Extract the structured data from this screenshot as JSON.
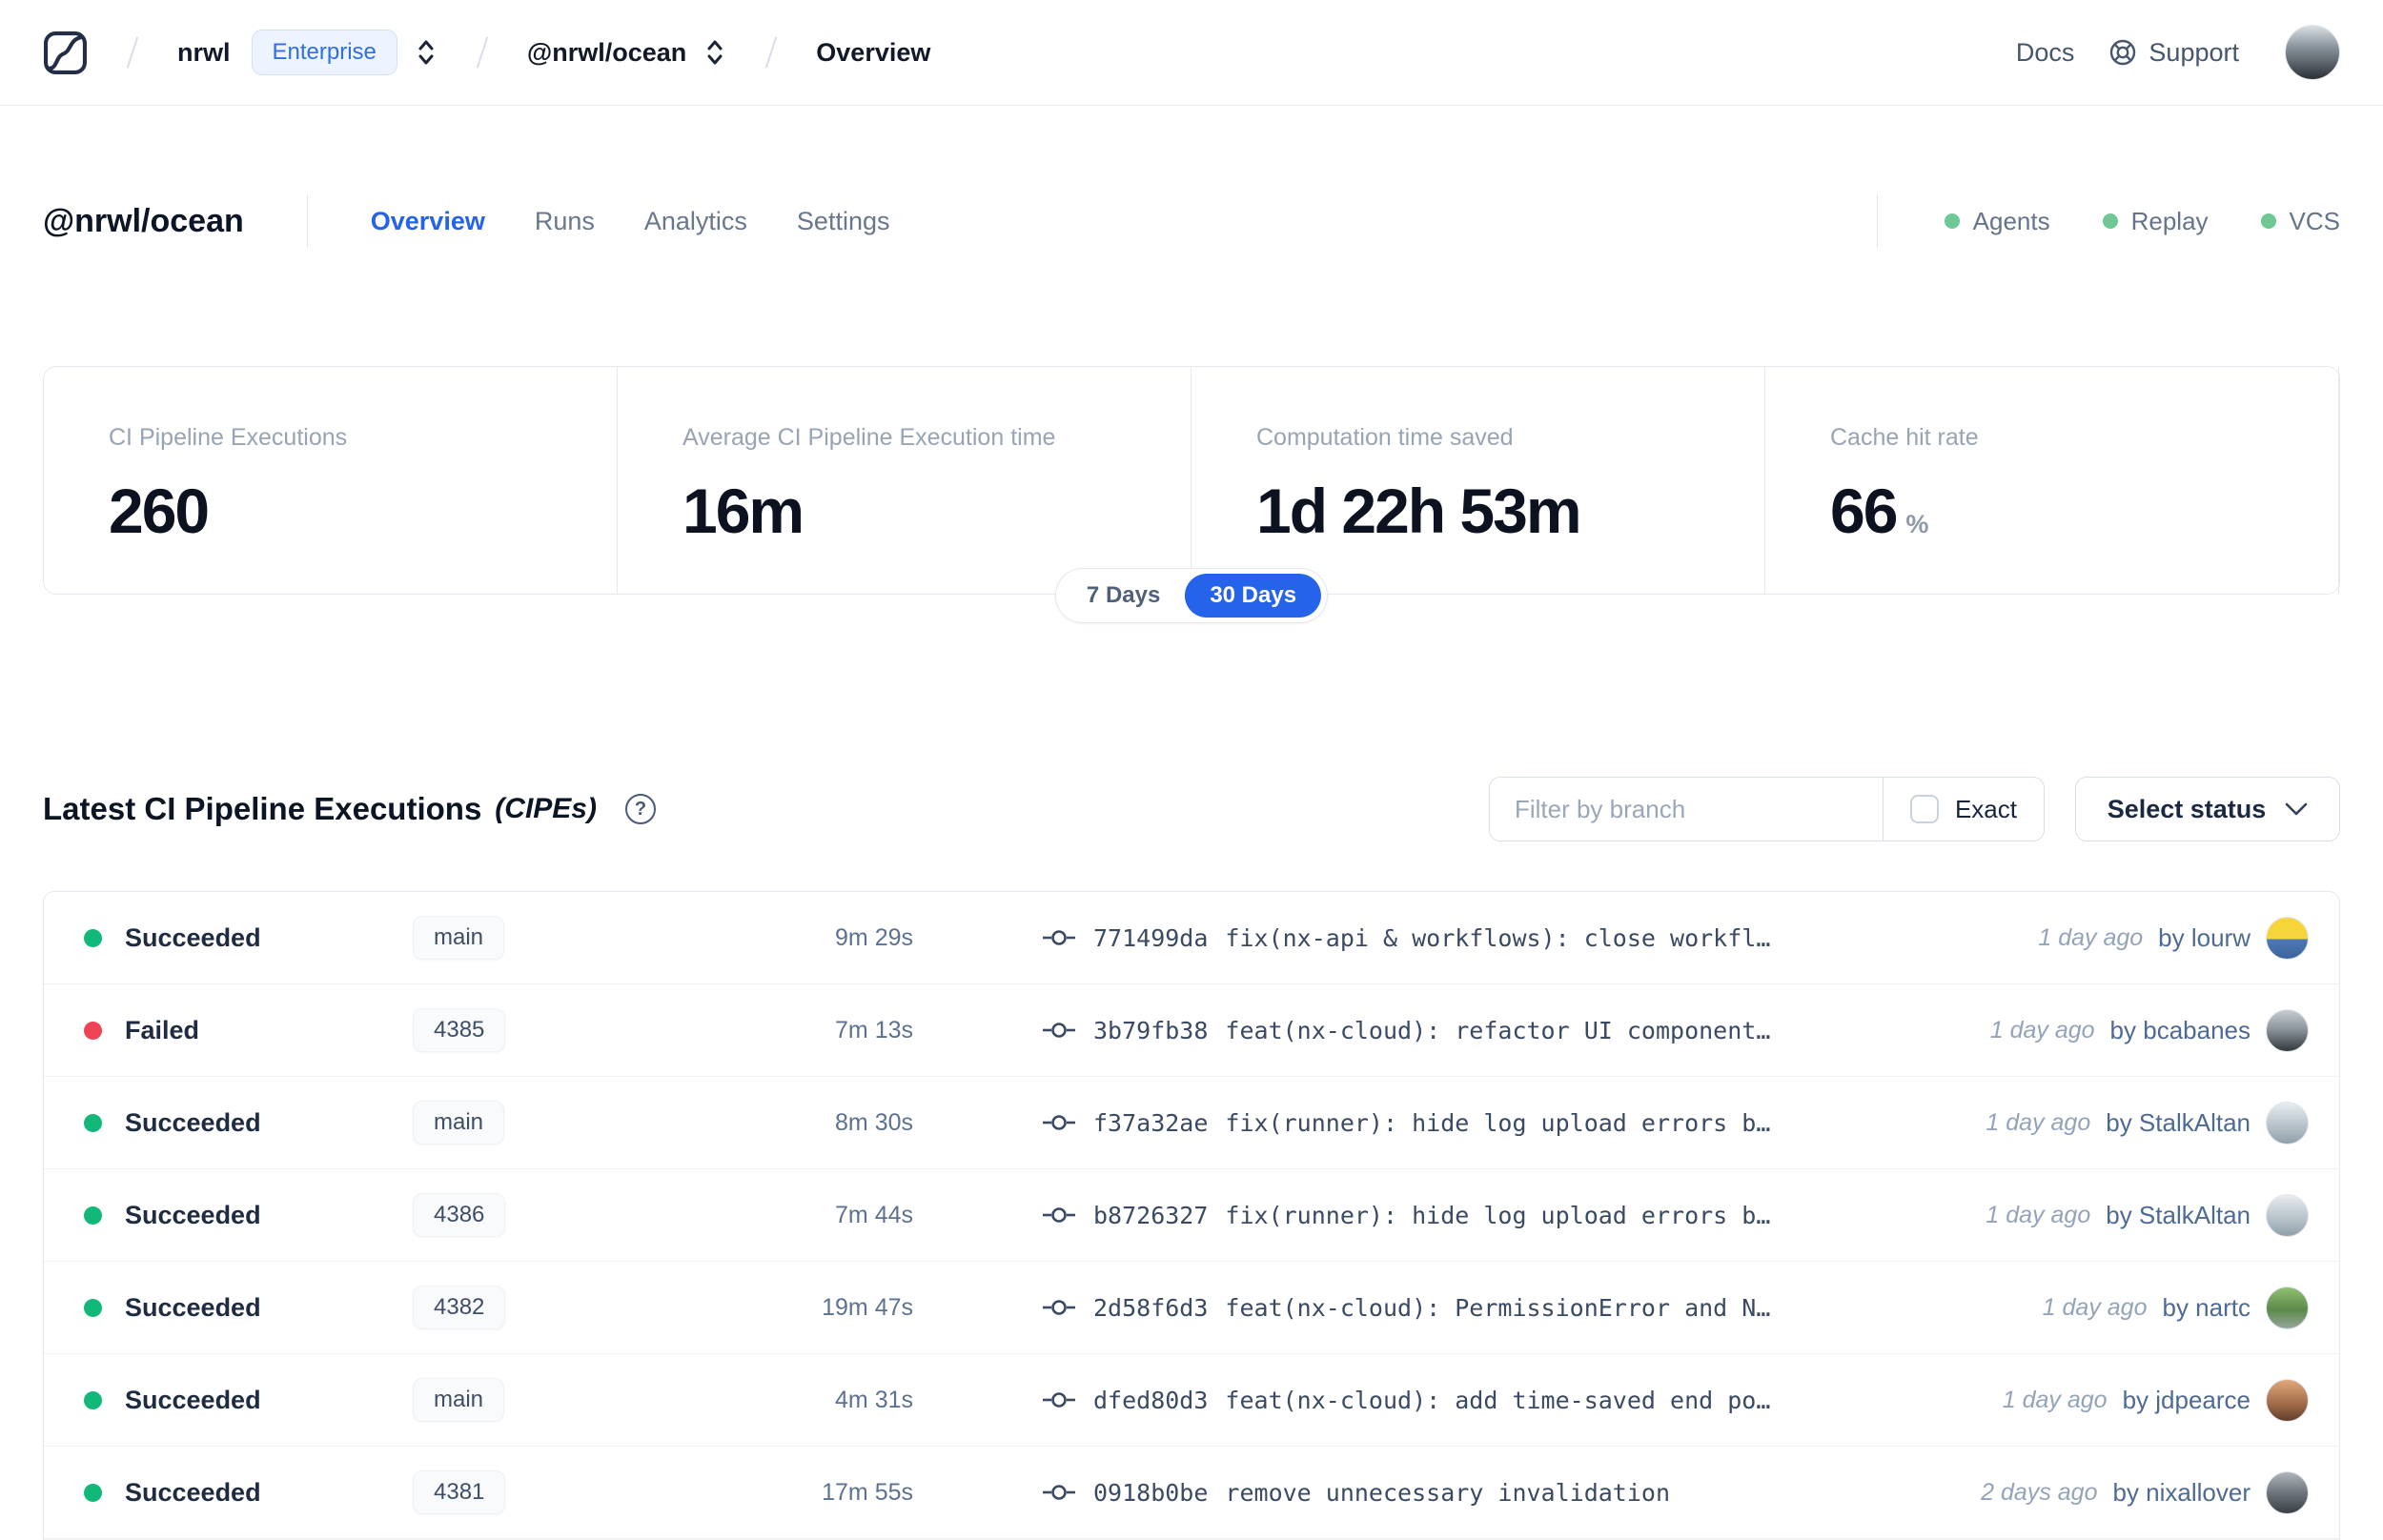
{
  "topnav": {
    "breadcrumb": {
      "org": "nrwl",
      "org_badge": "Enterprise",
      "workspace": "@nrwl/ocean",
      "page": "Overview"
    },
    "docs_label": "Docs",
    "support_label": "Support",
    "avatar_style": "background:linear-gradient(180deg,#d9e0e5 0%,#8a949d 40%,#2b3036 100%)"
  },
  "header": {
    "title": "@nrwl/ocean",
    "tabs": [
      {
        "label": "Overview",
        "active": true
      },
      {
        "label": "Runs",
        "active": false
      },
      {
        "label": "Analytics",
        "active": false
      },
      {
        "label": "Settings",
        "active": false
      }
    ],
    "services": [
      {
        "label": "Agents"
      },
      {
        "label": "Replay"
      },
      {
        "label": "VCS"
      }
    ]
  },
  "stats": {
    "cards": [
      {
        "label": "CI Pipeline Executions",
        "value": "260",
        "unit": ""
      },
      {
        "label": "Average CI Pipeline Execution time",
        "value": "16m",
        "unit": ""
      },
      {
        "label": "Computation time saved",
        "value": "1d 22h 53m",
        "unit": ""
      },
      {
        "label": "Cache hit rate",
        "value": "66",
        "unit": "%"
      }
    ],
    "range_toggle": {
      "seven": "7 Days",
      "thirty": "30 Days",
      "selected": "30 Days"
    }
  },
  "cipe_section": {
    "title": "Latest CI Pipeline Executions",
    "title_suffix": "(CIPEs)",
    "help_icon_glyph": "?",
    "filter_placeholder": "Filter by branch",
    "exact_label": "Exact",
    "status_button": "Select status"
  },
  "colors": {
    "accent": "#2563eb",
    "success": "#12b77a",
    "error": "#ee4257",
    "service_ok": "#6fc893"
  },
  "table": {
    "rows": [
      {
        "status": "Succeeded",
        "dot_style": "background:#12b77a",
        "branch": "main",
        "duration": "9m 29s",
        "commit_hash": "771499da",
        "commit_message": "fix(nx-api & workflows): close workfl…",
        "time_ago": "1 day ago",
        "author": "by lourw",
        "avatar_style": "background:linear-gradient(180deg,#f6d53a 0%,#f6d53a 52%,#4b79b7 52%,#3d659c 100%)"
      },
      {
        "status": "Failed",
        "dot_style": "background:#ee4257",
        "branch": "4385",
        "duration": "7m 13s",
        "commit_hash": "3b79fb38",
        "commit_message": "feat(nx-cloud): refactor UI component…",
        "time_ago": "1 day ago",
        "author": "by bcabanes",
        "avatar_style": "background:linear-gradient(180deg,#c7cdd2 0%,#8e979e 45%,#33383d 100%)"
      },
      {
        "status": "Succeeded",
        "dot_style": "background:#12b77a",
        "branch": "main",
        "duration": "8m 30s",
        "commit_hash": "f37a32ae",
        "commit_message": "fix(runner): hide log upload errors b…",
        "time_ago": "1 day ago",
        "author": "by StalkAltan",
        "avatar_style": "background:linear-gradient(180deg,#e8ecef 0%,#b9c4cc 55%,#8fa0ab 100%)"
      },
      {
        "status": "Succeeded",
        "dot_style": "background:#12b77a",
        "branch": "4386",
        "duration": "7m 44s",
        "commit_hash": "b8726327",
        "commit_message": "fix(runner): hide log upload errors b…",
        "time_ago": "1 day ago",
        "author": "by StalkAltan",
        "avatar_style": "background:linear-gradient(180deg,#e8ecef 0%,#b9c4cc 55%,#8fa0ab 100%)"
      },
      {
        "status": "Succeeded",
        "dot_style": "background:#12b77a",
        "branch": "4382",
        "duration": "19m 47s",
        "commit_hash": "2d58f6d3",
        "commit_message": "feat(nx-cloud): PermissionError and N…",
        "time_ago": "1 day ago",
        "author": "by nartc",
        "avatar_style": "background:linear-gradient(180deg,#8fbf72 0%,#5c8a4a 55%,#97a59a 100%)"
      },
      {
        "status": "Succeeded",
        "dot_style": "background:#12b77a",
        "branch": "main",
        "duration": "4m 31s",
        "commit_hash": "dfed80d3",
        "commit_message": "feat(nx-cloud): add time-saved end po…",
        "time_ago": "1 day ago",
        "author": "by jdpearce",
        "avatar_style": "background:linear-gradient(180deg,#e0a87a 0%,#a06a48 60%,#5f3e2c 100%)"
      },
      {
        "status": "Succeeded",
        "dot_style": "background:#12b77a",
        "branch": "4381",
        "duration": "17m 55s",
        "commit_hash": "0918b0be",
        "commit_message": "remove unnecessary invalidation",
        "time_ago": "2 days ago",
        "author": "by nixallover",
        "avatar_style": "background:linear-gradient(180deg,#aeb4ba 0%,#6d747b 50%,#3a3f45 100%)"
      }
    ]
  }
}
